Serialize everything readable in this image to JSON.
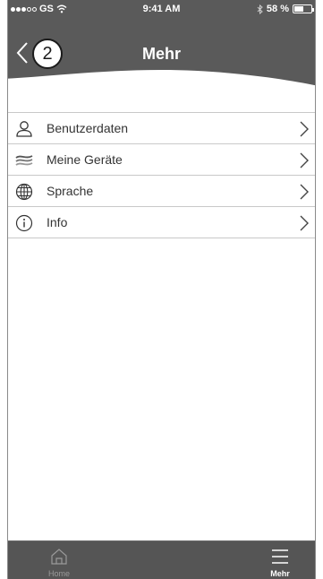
{
  "status_bar": {
    "carrier": "GS",
    "time": "9:41 AM",
    "battery": "58 %",
    "battery_level": 0.58,
    "wifi_icon": "wifi-icon",
    "bluetooth_icon": "bluetooth-icon"
  },
  "header": {
    "title": "Mehr",
    "back_icon": "chevron-left-icon",
    "callout_number": "2",
    "background_color": "#5a5a5a"
  },
  "menu": {
    "items": [
      {
        "label": "Benutzerdaten",
        "icon": "user-icon"
      },
      {
        "label": "Meine Geräte",
        "icon": "waves-icon"
      },
      {
        "label": "Sprache",
        "icon": "globe-icon"
      },
      {
        "label": "Info",
        "icon": "info-icon"
      }
    ]
  },
  "tab_bar": {
    "home_label": "Home",
    "more_label": "Mehr",
    "home_icon": "home-icon",
    "more_icon": "menu-icon",
    "active": "Mehr"
  }
}
